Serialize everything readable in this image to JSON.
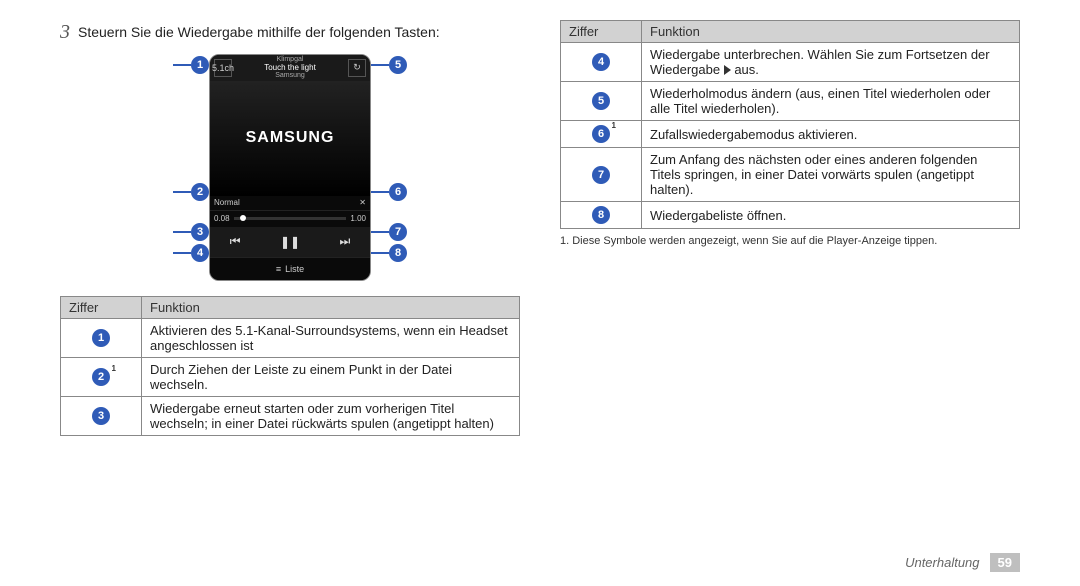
{
  "step": {
    "number": "3",
    "text": "Steuern Sie die Wiedergabe mithilfe der folgenden Tasten:"
  },
  "phone": {
    "album": "Klimpgal",
    "title": "Touch the light",
    "artist": "Samsung",
    "logo": "SAMSUNG",
    "mode": "Normal",
    "shuffle_glyph": "✕",
    "surr_glyph": "5.1ch",
    "repeat_glyph": "↻",
    "time_left": "0.08",
    "time_right": "1.00",
    "prev_glyph": "⏮",
    "pause_glyph": "❚❚",
    "next_glyph": "⏭",
    "liste_icon": "≡",
    "liste_label": "Liste"
  },
  "left_callouts": [
    "1",
    "2",
    "3",
    "4"
  ],
  "right_callouts": [
    "5",
    "6",
    "7",
    "8"
  ],
  "table_headers": {
    "ziffer": "Ziffer",
    "funktion": "Funktion"
  },
  "tableA": [
    {
      "n": "1",
      "sup": "",
      "text": "Aktivieren des 5.1-Kanal-Surroundsystems, wenn ein Headset angeschlossen ist"
    },
    {
      "n": "2",
      "sup": "1",
      "text": "Durch Ziehen der Leiste zu einem Punkt in der Datei wechseln."
    },
    {
      "n": "3",
      "sup": "",
      "text": "Wiedergabe erneut starten oder zum vorherigen Titel wechseln; in einer Datei rückwärts spulen (angetippt halten)"
    }
  ],
  "tableB": [
    {
      "n": "4",
      "sup": "",
      "html": "Wiedergabe unterbrechen. Wählen Sie zum Fortsetzen der Wiedergabe {PLAY} aus."
    },
    {
      "n": "5",
      "sup": "",
      "html": "Wiederholmodus ändern (aus, einen Titel wiederholen oder alle Titel wiederholen)."
    },
    {
      "n": "6",
      "sup": "1",
      "html": "Zufallswiedergabemodus aktivieren."
    },
    {
      "n": "7",
      "sup": "",
      "html": "Zum Anfang des nächsten oder eines anderen folgenden Titels springen, in einer Datei vorwärts spulen (angetippt halten)."
    },
    {
      "n": "8",
      "sup": "",
      "html": "Wiedergabeliste öffnen."
    }
  ],
  "footnote": "1. Diese Symbole werden angezeigt, wenn Sie auf die Player-Anzeige tippen.",
  "footer": {
    "section": "Unterhaltung",
    "page": "59"
  }
}
